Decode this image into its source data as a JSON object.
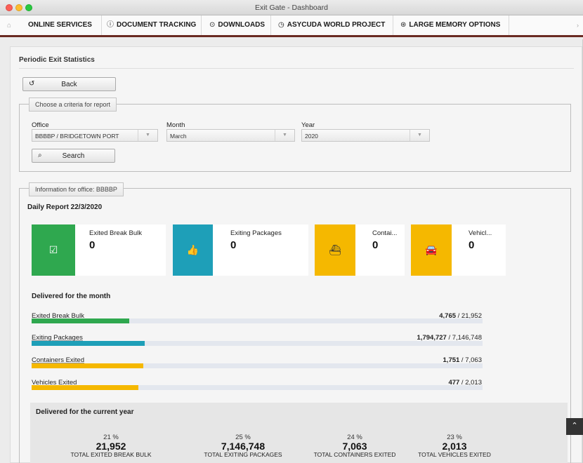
{
  "window": {
    "title": "Exit Gate - Dashboard"
  },
  "nav": {
    "home_icon": "home-icon",
    "items": [
      {
        "label": "ONLINE SERVICES",
        "icon": ""
      },
      {
        "label": "DOCUMENT TRACKING",
        "icon": "info-icon"
      },
      {
        "label": "DOWNLOADS",
        "icon": "download-icon"
      },
      {
        "label": "ASYCUDA WORLD PROJECT",
        "icon": "clock-icon"
      },
      {
        "label": "LARGE MEMORY OPTIONS",
        "icon": "dashboard-icon"
      }
    ],
    "icon_glyphs": {
      "info": "ⓘ",
      "download": "⊙",
      "clock": "◷",
      "dashboard": "⊛"
    }
  },
  "page": {
    "title": "Periodic Exit Statistics",
    "back_label": "Back",
    "criteria": {
      "legend": "Choose a criteria for report",
      "office_label": "Office",
      "office_value": "BBBBP / BRIDGETOWN PORT",
      "month_label": "Month",
      "month_value": "March",
      "year_label": "Year",
      "year_value": "2020",
      "search_label": "Search"
    },
    "info": {
      "legend": "Information for office: BBBBP",
      "daily_title": "Daily Report 22/3/2020",
      "cards": [
        {
          "title": "Exited Break Bulk",
          "value": "0",
          "color": "#2fa84f",
          "icon": "check-square-icon"
        },
        {
          "title": "Exiting Packages",
          "value": "0",
          "color": "#1e9fb8",
          "icon": "thumbs-up-icon"
        },
        {
          "title": "Contai...",
          "value": "0",
          "color": "#f5b800",
          "icon": "ship-icon"
        },
        {
          "title": "Vehicl...",
          "value": "0",
          "color": "#f5b800",
          "icon": "car-icon"
        }
      ],
      "month_title": "Delivered for the month",
      "month_rows": [
        {
          "label": "Exited Break Bulk",
          "value": "4,765",
          "total": " / 21,952",
          "fraction": 0.217,
          "color": "#2fa84f"
        },
        {
          "label": "Exiting Packages",
          "value": "1,794,727",
          "total": " / 7,146,748",
          "fraction": 0.251,
          "color": "#1e9fb8"
        },
        {
          "label": "Containers Exited",
          "value": "1,751",
          "total": " / 7,063",
          "fraction": 0.248,
          "color": "#f5b800"
        },
        {
          "label": "Vehicles Exited",
          "value": "477",
          "total": " / 2,013",
          "fraction": 0.237,
          "color": "#f5b800"
        }
      ],
      "year_title": "Delivered for the current year",
      "year_stats": [
        {
          "pct": "21 %",
          "value": "21,952",
          "label": "TOTAL EXITED BREAK BULK"
        },
        {
          "pct": "25 %",
          "value": "7,146,748",
          "label": "TOTAL EXITING PACKAGES"
        },
        {
          "pct": "24 %",
          "value": "7,063",
          "label": "TOTAL CONTAINERS EXITED"
        },
        {
          "pct": "23 %",
          "value": "2,013",
          "label": "TOTAL VEHICLES EXITED"
        }
      ]
    }
  }
}
